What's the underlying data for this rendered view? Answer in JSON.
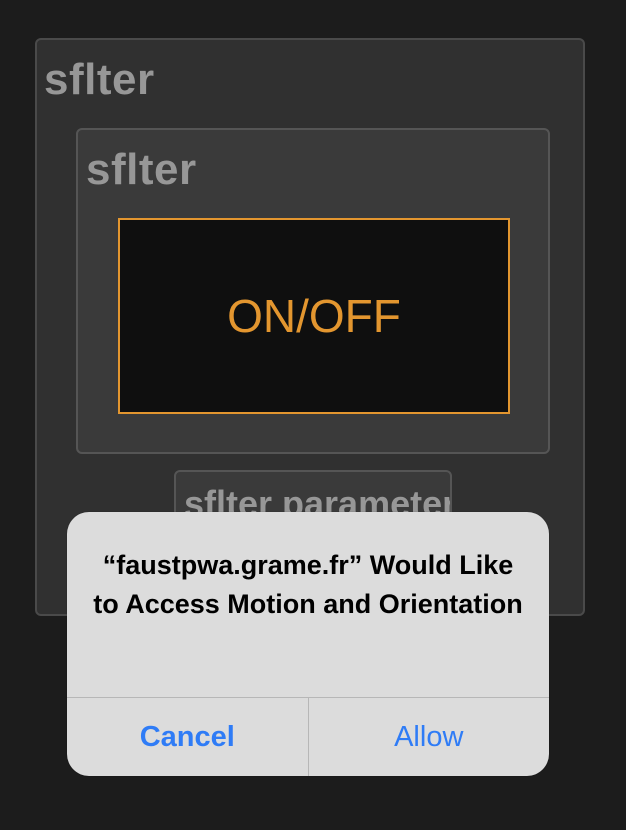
{
  "outer_group": {
    "title": "sflter"
  },
  "inner_group": {
    "title": "sflter",
    "toggle": {
      "label": "ON/OFF"
    }
  },
  "param_group": {
    "title": "sflter parameter(s)"
  },
  "alert": {
    "message": "“faustpwa.grame.fr” Would Like to Access Motion and Orientation",
    "cancel_label": "Cancel",
    "allow_label": "Allow"
  },
  "colors": {
    "background": "#1c1c1c",
    "accent_orange": "#e3962f",
    "ios_blue": "#2f7cf6",
    "alert_bg": "#dcdcdc"
  }
}
